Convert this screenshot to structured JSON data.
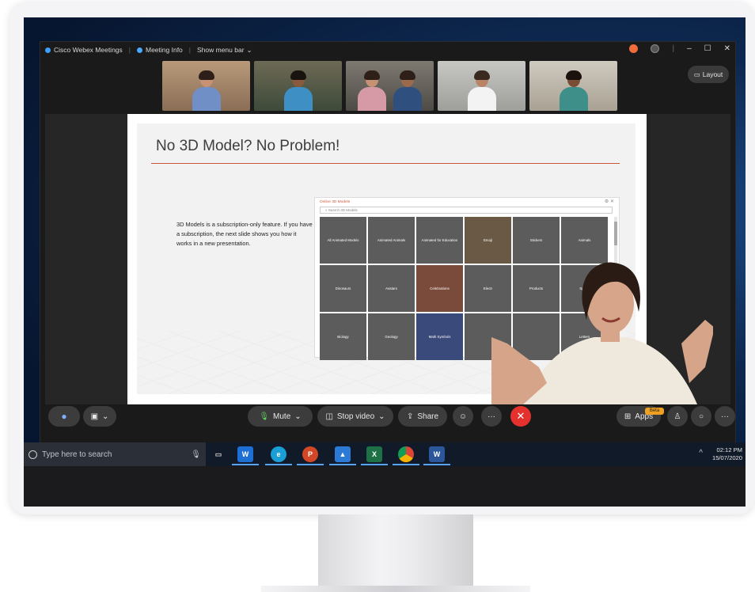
{
  "window": {
    "app_title": "Cisco Webex Meetings",
    "meeting_info": "Meeting Info",
    "menu_bar": "Show menu bar",
    "layout_label": "Layout"
  },
  "slide": {
    "title": "No 3D Model? No Problem!",
    "body": "3D Models is a subscription-only feature. If you have a subscription, the next slide shows you how it works in a new presentation.",
    "dialog_title": "Online 3D Models",
    "search_placeholder": "Search 3D Models",
    "categories": [
      "All Animated Models",
      "Animated Animals",
      "Animated for Education",
      "Emoji",
      "Stickers",
      "Animals",
      "Dinosaurs",
      "Avatars",
      "Celebrations",
      "Electr",
      "Products",
      "Space",
      "Biology",
      "Geology",
      "Math Symbols",
      "",
      "",
      "Letters"
    ]
  },
  "controls": {
    "mute": "Mute",
    "stop_video": "Stop video",
    "share": "Share",
    "apps": "Apps",
    "beta": "Beta"
  },
  "taskbar": {
    "search_placeholder": "Type here to search",
    "time": "02:12 PM",
    "date": "15/07/2020"
  },
  "colors": {
    "end_call": "#e5312d",
    "accent": "#c9573a"
  }
}
